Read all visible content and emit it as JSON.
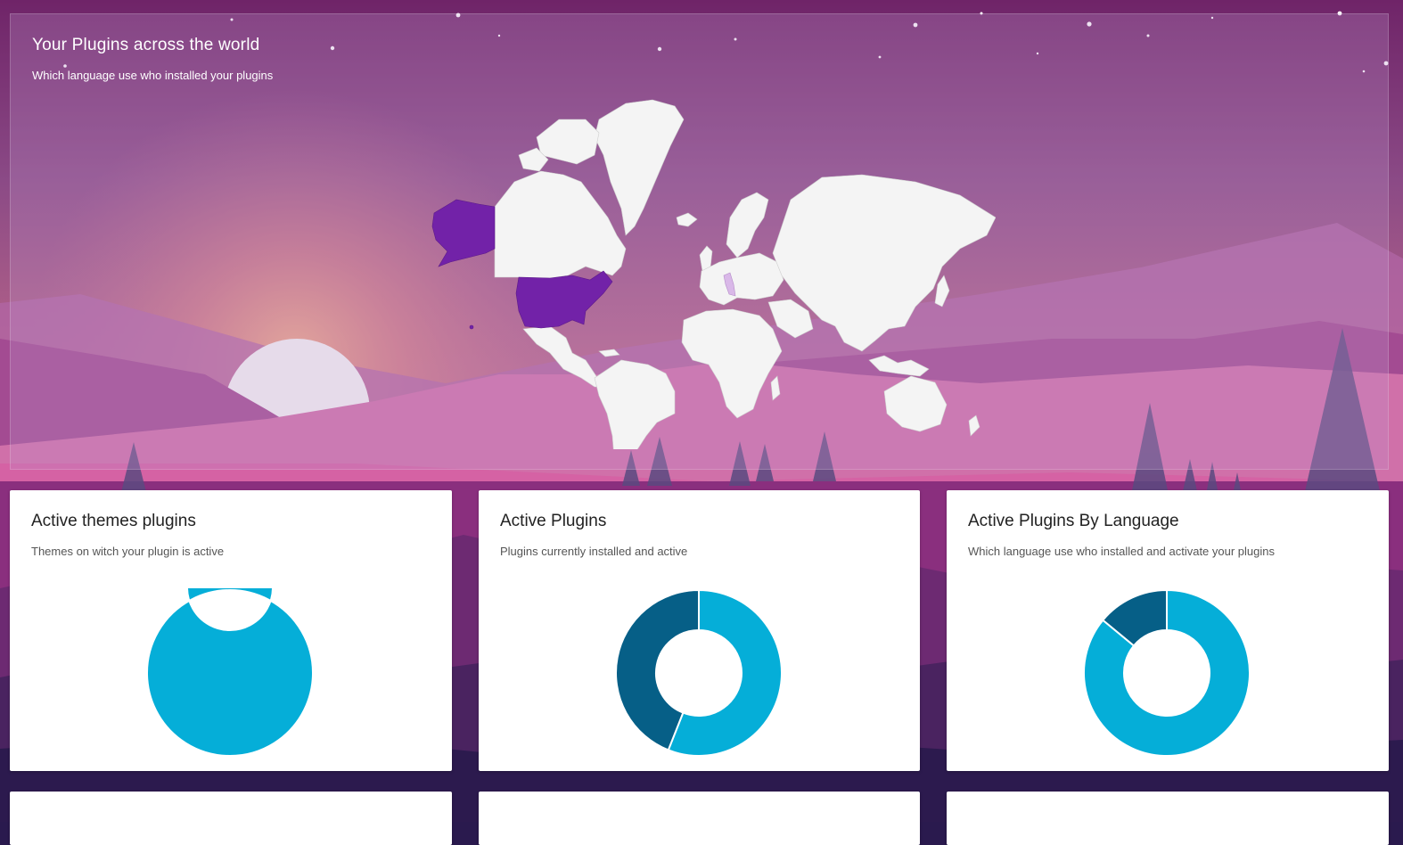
{
  "map_panel": {
    "title": "Your Plugins across the world",
    "subtitle": "Which language use who installed your plugins",
    "highlight_color": "#7222a8",
    "land_color": "#f4f4f4"
  },
  "cards": [
    {
      "title": "Active themes plugins",
      "subtitle": "Themes on witch your plugin is active",
      "chart_data": {
        "type": "pie",
        "donut": true,
        "values": [
          100
        ],
        "colors": [
          "#05aed8"
        ],
        "title": ""
      }
    },
    {
      "title": "Active Plugins",
      "subtitle": "Plugins currently installed and active",
      "chart_data": {
        "type": "pie",
        "donut": true,
        "values": [
          56,
          44
        ],
        "colors": [
          "#05aed8",
          "#065f87"
        ],
        "title": ""
      }
    },
    {
      "title": "Active Plugins By Language",
      "subtitle": "Which language use who installed and activate your plugins",
      "chart_data": {
        "type": "pie",
        "donut": true,
        "values": [
          86,
          14
        ],
        "colors": [
          "#05aed8",
          "#065f87"
        ],
        "title": ""
      }
    }
  ],
  "bottom_cards": [
    {
      "title": ""
    },
    {
      "title": ""
    },
    {
      "title": ""
    }
  ],
  "colors": {
    "accent": "#05aed8",
    "accent_dark": "#065f87",
    "sky_top": "#7a2c6e",
    "sun": "#f5f5f5"
  }
}
